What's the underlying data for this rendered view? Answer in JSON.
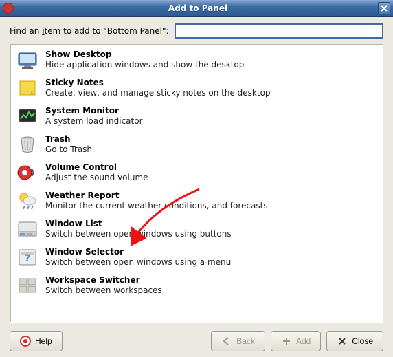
{
  "window": {
    "title": "Add to Panel"
  },
  "search": {
    "label_pre": "Find an ",
    "label_u": "i",
    "label_post": "tem to add to \"Bottom Panel\":",
    "value": "",
    "placeholder": ""
  },
  "items": [
    {
      "icon": "show-desktop-icon",
      "title": "Show Desktop",
      "desc": "Hide application windows and show the desktop"
    },
    {
      "icon": "sticky-notes-icon",
      "title": "Sticky Notes",
      "desc": "Create, view, and manage sticky notes on the desktop"
    },
    {
      "icon": "system-monitor-icon",
      "title": "System Monitor",
      "desc": "A system load indicator"
    },
    {
      "icon": "trash-icon",
      "title": "Trash",
      "desc": "Go to Trash"
    },
    {
      "icon": "volume-control-icon",
      "title": "Volume Control",
      "desc": "Adjust the sound volume"
    },
    {
      "icon": "weather-report-icon",
      "title": "Weather Report",
      "desc": "Monitor the current weather conditions, and forecasts"
    },
    {
      "icon": "window-list-icon",
      "title": "Window List",
      "desc": "Switch between open windows using buttons"
    },
    {
      "icon": "window-selector-icon",
      "title": "Window Selector",
      "desc": "Switch between open windows using a menu"
    },
    {
      "icon": "workspace-switcher-icon",
      "title": "Workspace Switcher",
      "desc": "Switch between workspaces"
    }
  ],
  "buttons": {
    "help": "Help",
    "back": "Back",
    "add": "Add",
    "close": "Close"
  }
}
